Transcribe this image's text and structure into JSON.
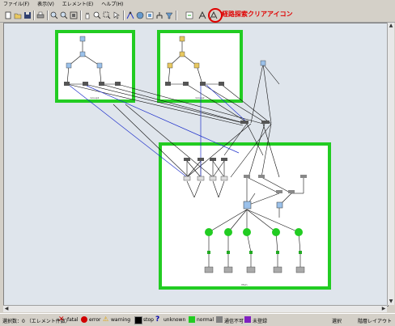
{
  "menu": {
    "file": "ファイル(F)",
    "view": "表示(V)",
    "element": "エレメント(E)",
    "help": "ヘルプ(H)"
  },
  "annotation": {
    "text": "経路探索クリアアイコン"
  },
  "groups": [
    {
      "label": "Group1"
    },
    {
      "label": "Group2"
    },
    {
      "label": "Main"
    }
  ],
  "status": {
    "count_label": "選択数：0 （エレメント件数）",
    "fatal": "fatal",
    "error": "error",
    "warning": "warning",
    "stop": "stop",
    "unknown": "unknown",
    "normal": "normal",
    "unreachable": "通信不可",
    "unregistered": "未登録",
    "select": "選択",
    "layout": "階層レイアウト"
  },
  "colors": {
    "group_border": "#22cc22",
    "link_black": "#111111",
    "link_blue": "#2233cc",
    "annotation": "#e00000"
  },
  "icons": [
    "new-icon",
    "open-icon",
    "save-icon",
    "print-icon",
    "zoom-in-icon",
    "zoom-out-icon",
    "fit-icon",
    "hand-icon",
    "search-icon",
    "zoom-area-icon",
    "select-icon",
    "route-icon",
    "layout-icon",
    "map-icon",
    "tree-icon",
    "filter-icon",
    "export-icon",
    "route-clear-icon",
    "settings-icon"
  ]
}
